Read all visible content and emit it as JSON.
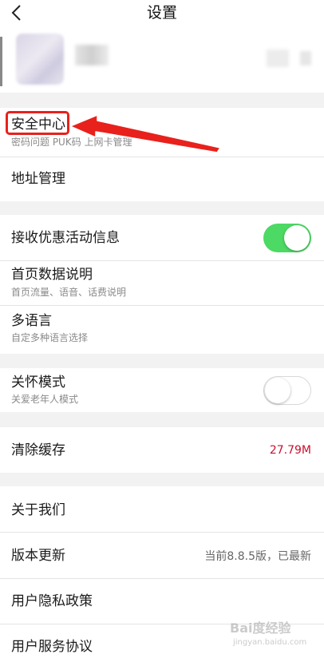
{
  "header": {
    "title": "设置",
    "back_icon": "chevron-left-icon"
  },
  "colors": {
    "toggle_on": "#4cd964",
    "cache_value": "#c8102e",
    "annotation_red": "#e8211c"
  },
  "security": {
    "title": "安全中心",
    "subtitle": "密码问题 PUK码 上网卡管理"
  },
  "address": {
    "title": "地址管理"
  },
  "promo": {
    "title": "接收优惠活动信息",
    "toggle_on": true
  },
  "homepage": {
    "title": "首页数据说明",
    "subtitle": "首页流量、语音、话费说明"
  },
  "language": {
    "title": "多语言",
    "subtitle": "自定多种语言选择"
  },
  "care": {
    "title": "关怀模式",
    "subtitle": "关爱老年人模式",
    "toggle_on": false
  },
  "cache": {
    "title": "清除缓存",
    "value": "27.79M"
  },
  "about": {
    "title": "关于我们"
  },
  "update": {
    "title": "版本更新",
    "value": "当前8.8.5版，已最新"
  },
  "privacy": {
    "title": "用户隐私政策"
  },
  "service": {
    "title": "用户服务协议"
  },
  "watermark": {
    "main": "Bai度经验",
    "sub": "jingyan.baidu.com"
  }
}
